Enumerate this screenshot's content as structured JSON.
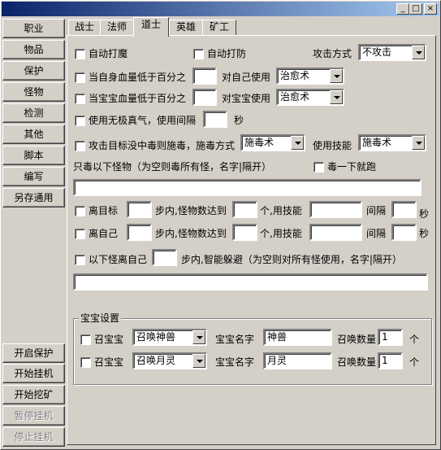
{
  "window": {
    "min": "_",
    "max": "□",
    "close": "×"
  },
  "sidebar": {
    "top": [
      "职业",
      "物品",
      "保护",
      "怪物",
      "检测",
      "其他",
      "脚本",
      "编写",
      "另存通用"
    ],
    "bottom": [
      "开启保护",
      "开始挂机",
      "开始挖矿",
      "暂停挂机",
      "停止挂机"
    ]
  },
  "tabs": [
    "战士",
    "法师",
    "道士",
    "英雄",
    "矿工"
  ],
  "active_tab": "道士",
  "form": {
    "auto_charm": "自动打魔",
    "auto_defense": "自动打防",
    "attack_mode_label": "攻击方式",
    "attack_mode_value": "不攻击",
    "self_hp_label": "当自身血量低于百分之",
    "self_use_label": "对自己使用",
    "self_skill": "治愈术",
    "pet_hp_label": "当宝宝血量低于百分之",
    "pet_use_label": "对宝宝使用",
    "pet_skill": "治愈术",
    "wuji_label": "使用无极真气，使用间隔",
    "seconds": "秒",
    "poison_label": "攻击目标没中毒则施毒，施毒方式",
    "poison_mode": "施毒术",
    "use_skill_label": "使用技能",
    "use_skill_value": "施毒术",
    "poison_only_label": "只毒以下怪物（为空则毒所有怪，名字|隔开）",
    "poison_run_label": "毒一下就跑",
    "away_target_label": "离目标",
    "away_self_label": "离自己",
    "steps_label": "步内,怪物数达到",
    "count_skill_label": "个,用技能",
    "interval_label": "间隔",
    "sec2": "秒",
    "monster_near_label": "以下怪离自己",
    "smart_dodge_label": "步内,智能躲避（为空则对所有怪使用，名字|隔开）"
  },
  "pets": {
    "group_title": "宝宝设置",
    "rows": [
      {
        "summon_label": "召宝宝",
        "skill": "召唤神兽",
        "name_label": "宝宝名字",
        "name": "神兽",
        "count_label": "召唤数量",
        "count": "1",
        "unit": "个"
      },
      {
        "summon_label": "召宝宝",
        "skill": "召唤月灵",
        "name_label": "宝宝名字",
        "name": "月灵",
        "count_label": "召唤数量",
        "count": "1",
        "unit": "个"
      }
    ]
  }
}
